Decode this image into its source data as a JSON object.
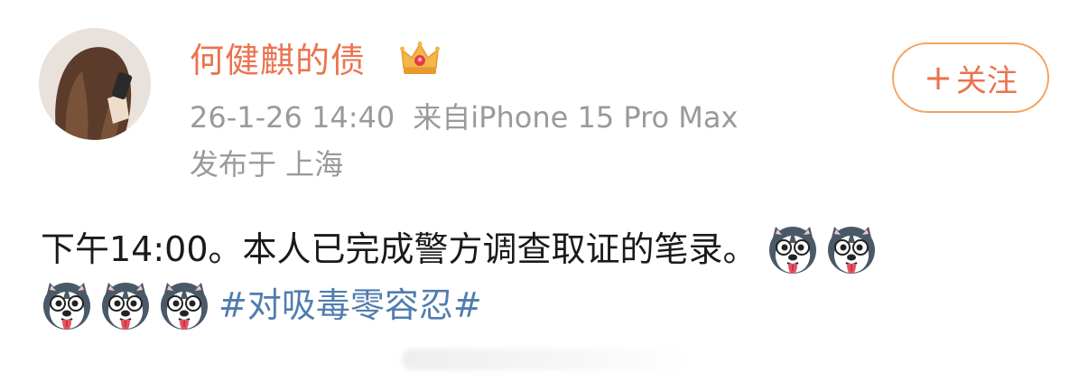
{
  "user": {
    "name": "何健麒的债",
    "crown_icon": "crown-icon",
    "avatar_icon": "avatar-image"
  },
  "post_meta": {
    "time": "26-1-26 14:40",
    "source": "来自iPhone 15 Pro Max",
    "location": "发布于 上海"
  },
  "follow_button": {
    "plus": "+",
    "label": "关注"
  },
  "content": {
    "text": "下午14:00。本人已完成警方调查取证的笔录。",
    "hashtag": "#对吸毒零容忍#",
    "emoji_icon": "husky-dog-emoji"
  },
  "colors": {
    "username": "#eb7350",
    "follow_border": "#f5a35f",
    "meta_gray": "#9a9a9a",
    "hashtag": "#507daf",
    "text": "#1a1a1a"
  }
}
